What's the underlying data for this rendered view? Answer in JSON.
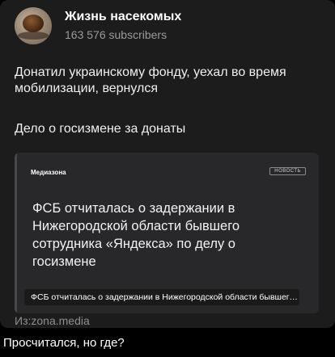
{
  "channel": {
    "name": "Жизнь насекомых",
    "subscribers": "163 576 subscribers",
    "avatar_icon": "beetle-avatar"
  },
  "post": {
    "line1": "Донатил украинскому фонду, уехал во время мобилизации, вернулся",
    "line2": "Дело о госизмене за донаты"
  },
  "link_preview": {
    "site": "Медиазона",
    "tag": "НОВОСТЬ",
    "headline": "ФСБ отчиталась о задержании в Нижегородской области бывшего сотрудника «Яндекса» по делу о госизмене",
    "caption": "ФСБ отчиталась о задержании в Нижегородской области бывшего сотрудника «Яндекса» по делу о госизмене"
  },
  "source": "Из:zona.media",
  "reply": {
    "text": "Просчитался, но где?"
  }
}
